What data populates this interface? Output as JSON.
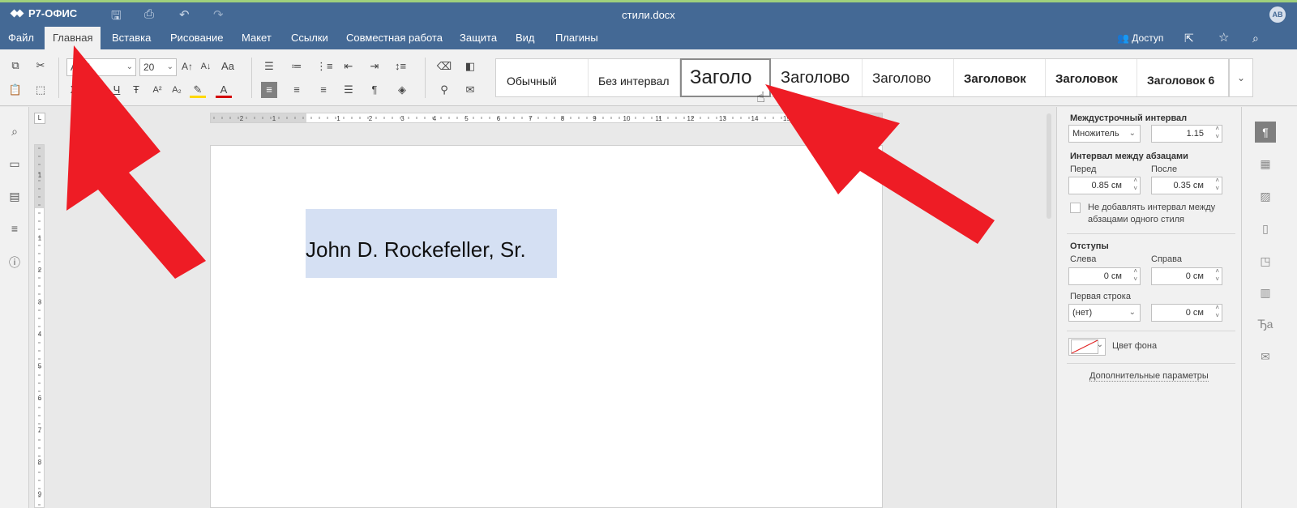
{
  "app": {
    "logo": "Р7-ОФИС",
    "doc_title": "стили.docx",
    "avatar": "АВ"
  },
  "menu": {
    "tabs": [
      "Файл",
      "Главная",
      "Вставка",
      "Рисование",
      "Макет",
      "Ссылки",
      "Совместная работа",
      "Защита",
      "Вид",
      "Плагины"
    ],
    "access_label": "Доступ"
  },
  "toolbar": {
    "font_name": "Arial",
    "font_size": "20",
    "bold": "Ж",
    "italic": "К",
    "underline": "Ч",
    "strike": "Ŧ",
    "superscript": "A²",
    "subscript": "A₂",
    "grow": "A↑",
    "shrink": "A↓",
    "case": "Aa",
    "font_color": "A"
  },
  "styles": [
    "Обычный",
    "Без интервал",
    "Заголо",
    "Заголово",
    "Заголово",
    "Заголовок",
    "Заголовок",
    "Заголовок 6"
  ],
  "document": {
    "text": "John D. Rockefeller, Sr."
  },
  "ruler": {
    "h_ticks": [
      "2",
      "1",
      "1",
      "2",
      "3",
      "4",
      "5",
      "6",
      "7",
      "8",
      "9",
      "10",
      "11",
      "12",
      "13",
      "14",
      "15"
    ],
    "v_ticks": [
      "1",
      "1",
      "2",
      "3",
      "4",
      "5",
      "6",
      "7",
      "8",
      "9"
    ]
  },
  "panel": {
    "line_spacing_title": "Междустрочный интервал",
    "line_spacing_mode": "Множитель",
    "line_spacing_value": "1.15",
    "para_spacing_title": "Интервал между абзацами",
    "before_label": "Перед",
    "after_label": "После",
    "before_value": "0.85 см",
    "after_value": "0.35 см",
    "no_add_label_1": "Не добавлять интервал между",
    "no_add_label_2": "абзацами одного стиля",
    "indents_title": "Отступы",
    "left_label": "Слева",
    "right_label": "Справа",
    "left_value": "0 см",
    "right_value": "0 см",
    "first_line_label": "Первая строка",
    "first_line_mode": "(нет)",
    "first_line_value": "0 см",
    "bg_color_label": "Цвет фона",
    "advanced_link": "Дополнительные параметры"
  },
  "colors": {
    "header": "#446995",
    "toolbar": "#f1f1f1",
    "selection": "#d5e0f3",
    "arrow": "#ee1c25",
    "accent_green": "#9fd07c"
  }
}
